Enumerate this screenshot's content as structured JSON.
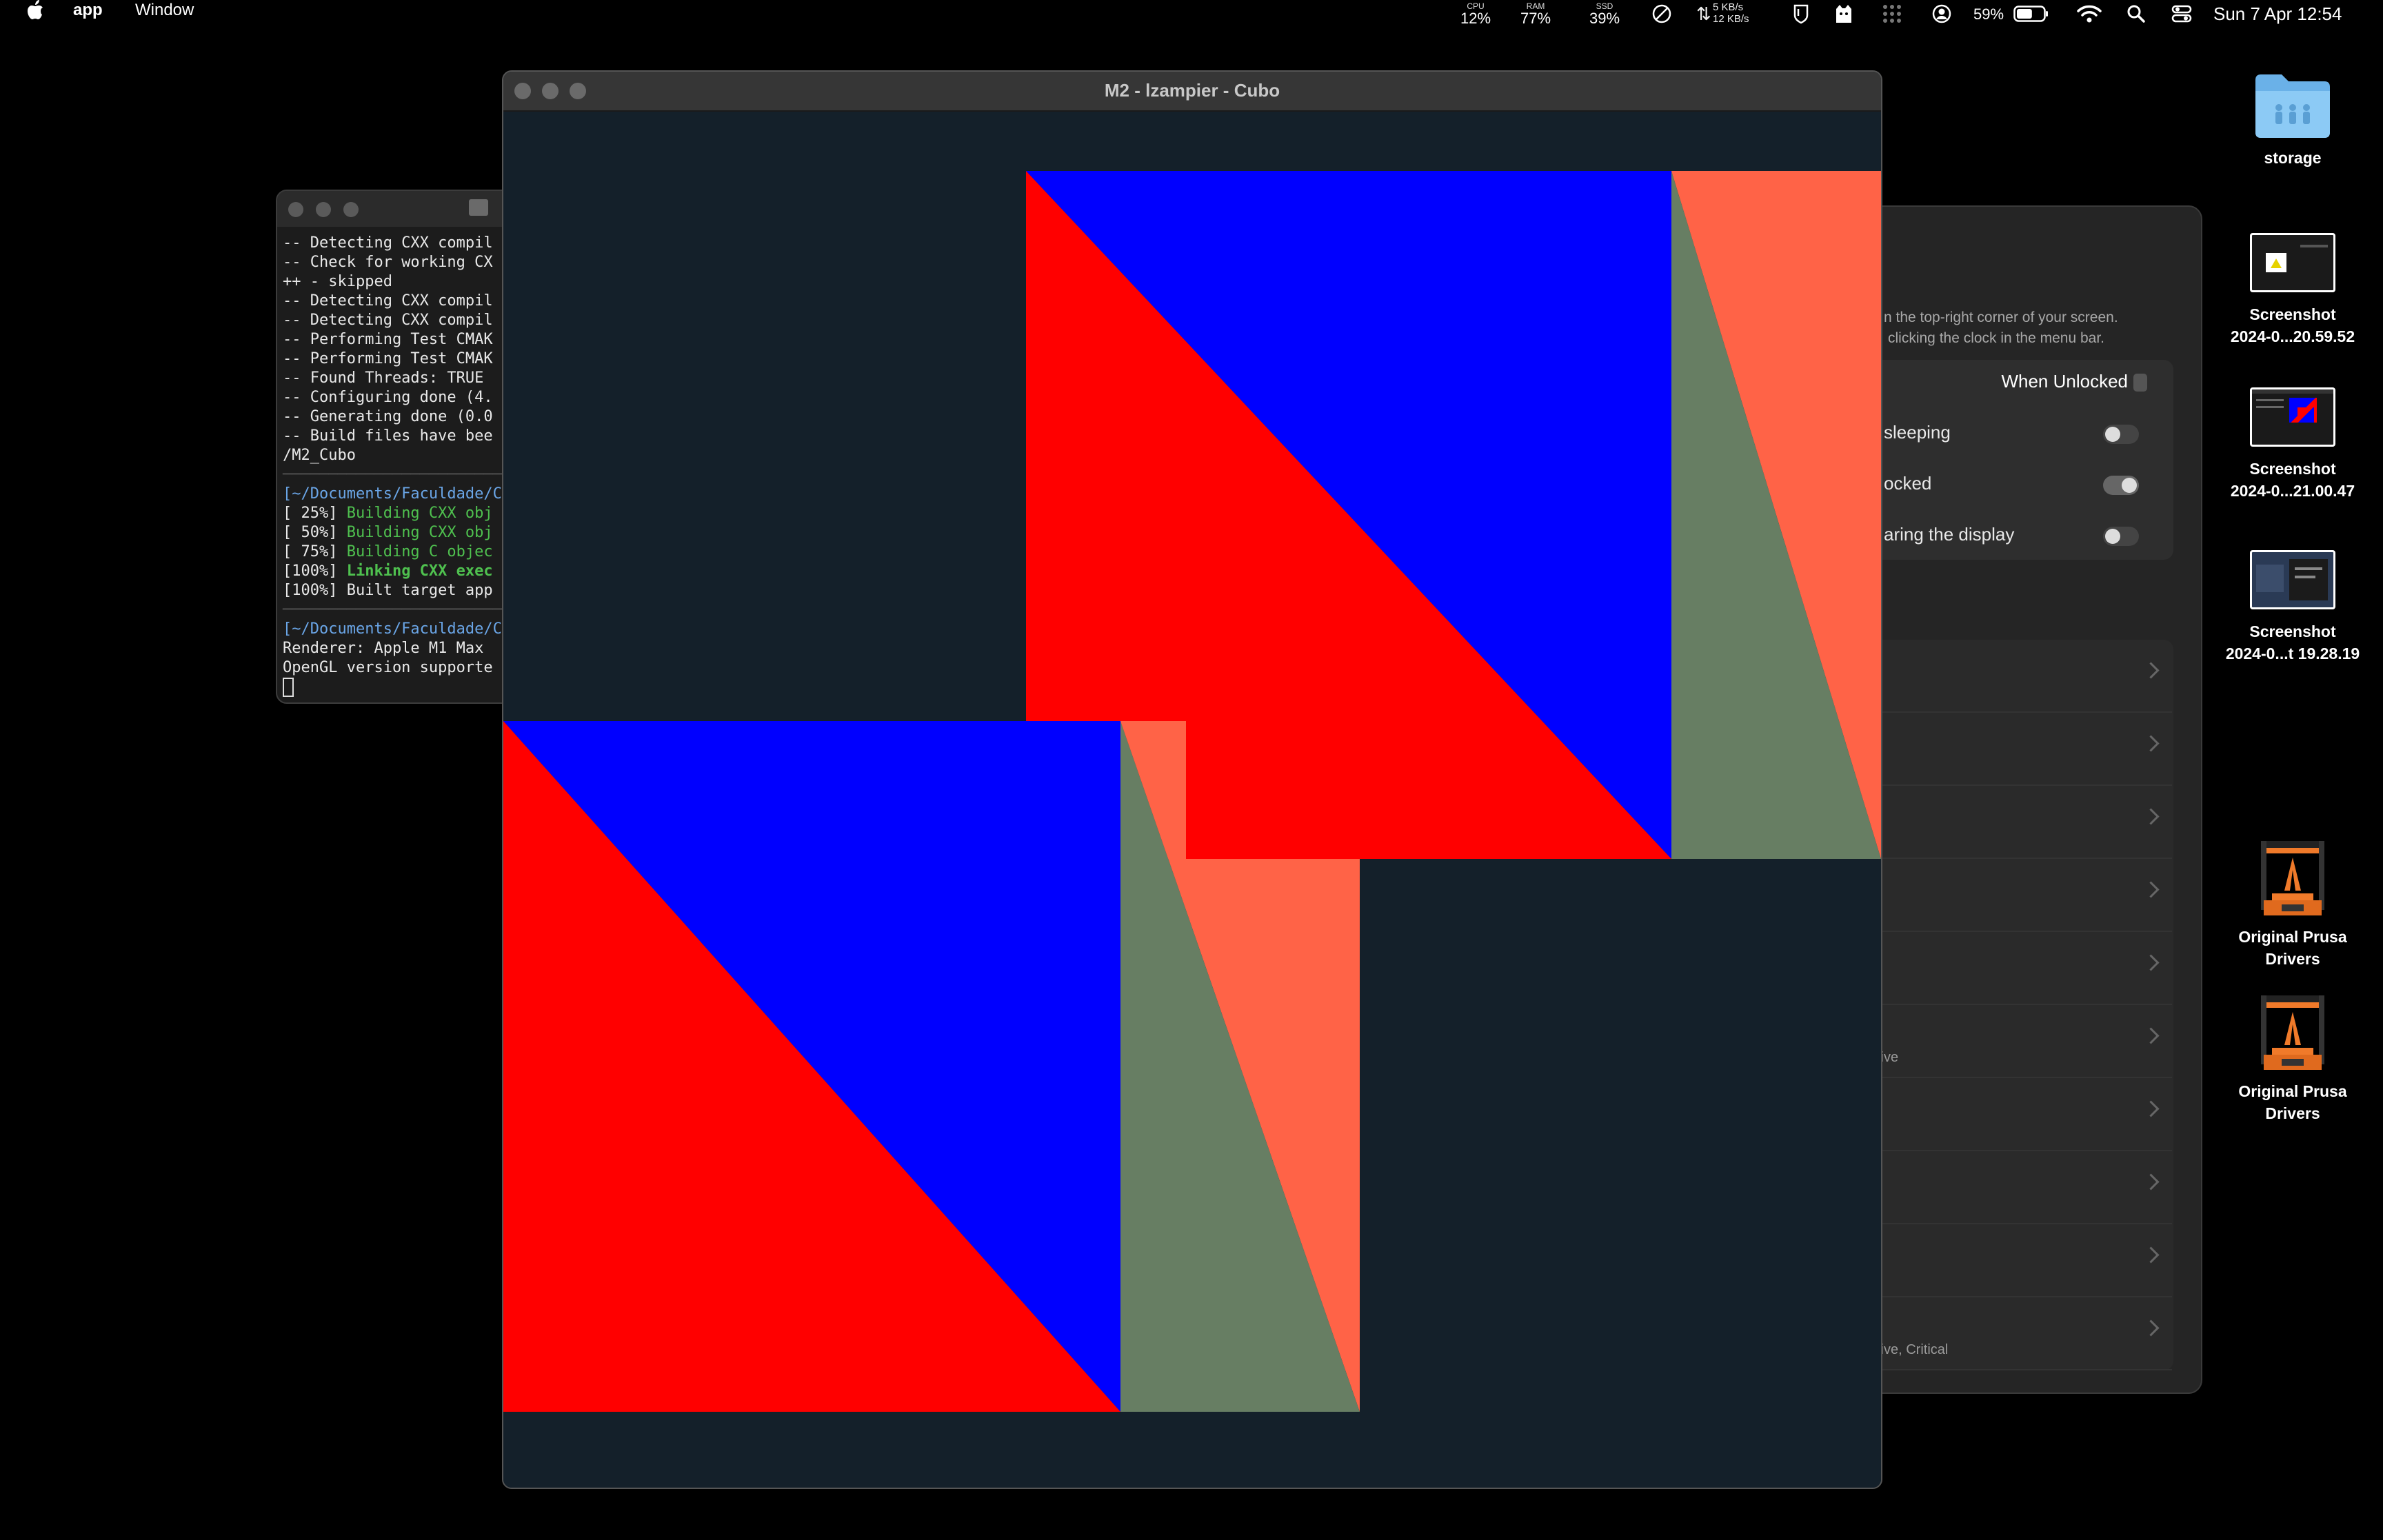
{
  "menubar": {
    "apple_icon": "apple-logo-icon",
    "app_name": "app",
    "window_menu": "Window",
    "stats": [
      {
        "label": "CPU",
        "value": "12%"
      },
      {
        "label": "RAM",
        "value": "77%"
      },
      {
        "label": "SSD",
        "value": "39%"
      }
    ],
    "network": {
      "up": "5 KB/s",
      "down": "12 KB/s"
    },
    "battery_percent": "59%",
    "battery_level": 0.59,
    "clock": "Sun 7 Apr  12:54",
    "icons": [
      "do-not-disturb-icon",
      "network-arrows-icon",
      "shield-icon",
      "cat-icon",
      "grid-icon",
      "user-icon",
      "battery-icon",
      "wifi-icon",
      "search-icon",
      "control-center-icon"
    ]
  },
  "gl_window": {
    "title": "M2 - lzampier - Cubo",
    "background": "#14202a",
    "colors": {
      "red": "#ff0000",
      "blue": "#0000ff",
      "coral": "#ff6347",
      "sage": "#677e63"
    }
  },
  "terminal": {
    "lines": [
      {
        "t": "-- Detecting CXX compil",
        "c": ""
      },
      {
        "t": "-- Check for working CX",
        "c": ""
      },
      {
        "t": "++ - skipped",
        "c": ""
      },
      {
        "t": "-- Detecting CXX compil",
        "c": ""
      },
      {
        "t": "-- Detecting CXX compil",
        "c": ""
      },
      {
        "t": "-- Performing Test CMAK",
        "c": ""
      },
      {
        "t": "-- Performing Test CMAK",
        "c": ""
      },
      {
        "t": "-- Found Threads: TRUE",
        "c": ""
      },
      {
        "t": "-- Configuring done (4.",
        "c": ""
      },
      {
        "t": "-- Generating done (0.0",
        "c": ""
      },
      {
        "t": "-- Build files have bee",
        "c": ""
      },
      {
        "t": "/M2_Cubo",
        "c": ""
      },
      {
        "t": "────────────────────────",
        "c": "t-sep"
      },
      {
        "t": "[~/Documents/Faculdade/C",
        "c": "t-path"
      },
      {
        "t": "[ 25%] ",
        "c": "",
        "g": "Building CXX obj"
      },
      {
        "t": "[ 50%] ",
        "c": "",
        "g": "Building CXX obj"
      },
      {
        "t": "[ 75%] ",
        "c": "",
        "g": "Building C objec"
      },
      {
        "t": "[100%] ",
        "c": "",
        "g": "Linking CXX exec",
        "b": true
      },
      {
        "t": "[100%] Built target app",
        "c": ""
      },
      {
        "t": "────────────────────────",
        "c": "t-sep"
      },
      {
        "t": "[~/Documents/Faculdade/C",
        "c": "t-path"
      },
      {
        "t": "Renderer: Apple M1 Max",
        "c": ""
      },
      {
        "t": "OpenGL version supporte",
        "c": ""
      }
    ]
  },
  "settings": {
    "desc_line1": "n the top-right corner of your screen.",
    "desc_line2": "clicking the clock in the menu bar.",
    "when_unlocked": "When Unlocked",
    "toggles": [
      {
        "label": "sleeping",
        "on": false
      },
      {
        "label": "ocked",
        "on": true
      },
      {
        "label": "aring the display",
        "on": false
      }
    ],
    "list_subs": [
      "",
      "",
      "",
      "",
      "",
      "tive",
      "",
      "",
      "",
      "tive, Critical"
    ]
  },
  "desktop": {
    "items": [
      {
        "label1": "storage",
        "label2": "",
        "kind": "folder"
      },
      {
        "label1": "Screenshot",
        "label2": "2024-0...20.59.52",
        "kind": "shot1"
      },
      {
        "label1": "Screenshot",
        "label2": "2024-0...21.00.47",
        "kind": "shot2"
      },
      {
        "label1": "Screenshot",
        "label2": "2024-0...t 19.28.19",
        "kind": "shot3"
      },
      {
        "label1": "Original Prusa",
        "label2": "Drivers",
        "kind": "prusa"
      },
      {
        "label1": "Original Prusa",
        "label2": "Drivers",
        "kind": "prusa"
      }
    ]
  }
}
